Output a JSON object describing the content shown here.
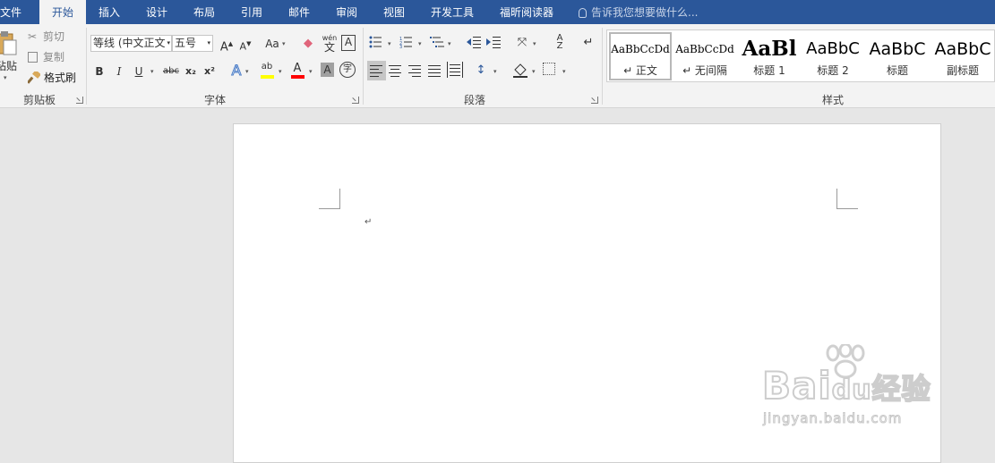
{
  "tabs": [
    {
      "label": "文件",
      "active": false
    },
    {
      "label": "开始",
      "active": true
    },
    {
      "label": "插入",
      "active": false
    },
    {
      "label": "设计",
      "active": false
    },
    {
      "label": "布局",
      "active": false
    },
    {
      "label": "引用",
      "active": false
    },
    {
      "label": "邮件",
      "active": false
    },
    {
      "label": "审阅",
      "active": false
    },
    {
      "label": "视图",
      "active": false
    },
    {
      "label": "开发工具",
      "active": false
    },
    {
      "label": "福昕阅读器",
      "active": false
    }
  ],
  "tell_me": "告诉我您想要做什么...",
  "clipboard": {
    "paste": "粘贴",
    "cut": "剪切",
    "copy": "复制",
    "format_painter": "格式刷",
    "group": "剪贴板"
  },
  "font": {
    "name": "等线 (中文正文",
    "size": "五号",
    "group": "字体",
    "wen": "wén",
    "wen_char": "文",
    "case": "Aa",
    "bold": "B",
    "italic": "I",
    "underline": "U",
    "strike": "abc",
    "sub": "x₂",
    "sup": "x²",
    "A": "A",
    "char_border": "A",
    "enclose": "字"
  },
  "paragraph": {
    "group": "段落"
  },
  "styles": {
    "group": "样式",
    "items": [
      {
        "preview": "AaBbCcDd",
        "name": "↵ 正文",
        "selected": true
      },
      {
        "preview": "AaBbCcDd",
        "name": "↵ 无间隔",
        "selected": false
      },
      {
        "preview": "AaBl",
        "name": "标题 1",
        "selected": false
      },
      {
        "preview": "AaBbC",
        "name": "标题 2",
        "selected": false
      },
      {
        "preview": "AaBbC",
        "name": "标题",
        "selected": false
      },
      {
        "preview": "AaBbC",
        "name": "副标题",
        "selected": false
      }
    ]
  },
  "document": {
    "paragraph_mark": "↵"
  },
  "watermark": {
    "brand": "Bai",
    "du": "du",
    "jingyan": "经验",
    "url": "jingyan.baidu.com"
  },
  "colors": {
    "accent": "#2b579a",
    "highlight": "#ffff00",
    "font_color": "#ff0000"
  }
}
